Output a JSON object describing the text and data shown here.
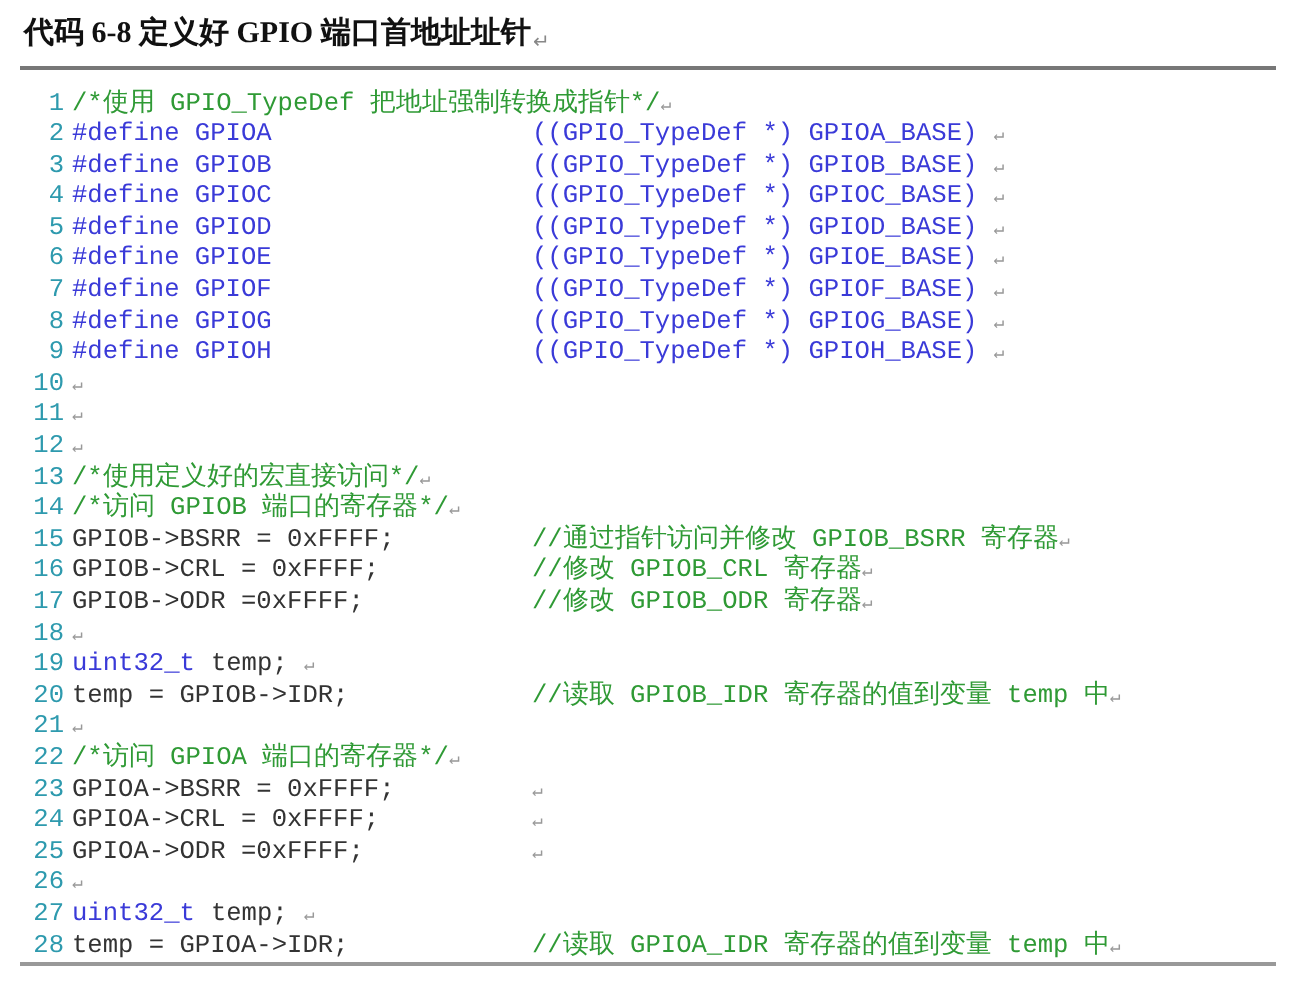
{
  "caption": {
    "text": "代码 6-8 定义好 GPIO 端口首地址址针",
    "mark": "↵"
  },
  "lines": [
    {
      "number": "1",
      "code": [
        {
          "kind": "comment",
          "text": "/*使用 GPIO_TypeDef 把地址强制转换成指针*/"
        },
        {
          "kind": "mark",
          "text": "↵"
        }
      ]
    },
    {
      "number": "2",
      "code": [
        {
          "kind": "keyword",
          "text": "#define GPIOA"
        }
      ],
      "tail": [
        {
          "kind": "keyword",
          "text": "((GPIO_TypeDef *) GPIOA_BASE)"
        },
        {
          "kind": "mark",
          "text": "↵"
        }
      ]
    },
    {
      "number": "3",
      "code": [
        {
          "kind": "keyword",
          "text": "#define GPIOB"
        }
      ],
      "tail": [
        {
          "kind": "keyword",
          "text": "((GPIO_TypeDef *) GPIOB_BASE)"
        },
        {
          "kind": "mark",
          "text": "↵"
        }
      ]
    },
    {
      "number": "4",
      "code": [
        {
          "kind": "keyword",
          "text": "#define GPIOC"
        }
      ],
      "tail": [
        {
          "kind": "keyword",
          "text": "((GPIO_TypeDef *) GPIOC_BASE)"
        },
        {
          "kind": "mark",
          "text": "↵"
        }
      ]
    },
    {
      "number": "5",
      "code": [
        {
          "kind": "keyword",
          "text": "#define GPIOD"
        }
      ],
      "tail": [
        {
          "kind": "keyword",
          "text": "((GPIO_TypeDef *) GPIOD_BASE)"
        },
        {
          "kind": "mark",
          "text": "↵"
        }
      ]
    },
    {
      "number": "6",
      "code": [
        {
          "kind": "keyword",
          "text": "#define GPIOE"
        }
      ],
      "tail": [
        {
          "kind": "keyword",
          "text": "((GPIO_TypeDef *) GPIOE_BASE)"
        },
        {
          "kind": "mark",
          "text": "↵"
        }
      ]
    },
    {
      "number": "7",
      "code": [
        {
          "kind": "keyword",
          "text": "#define GPIOF"
        }
      ],
      "tail": [
        {
          "kind": "keyword",
          "text": "((GPIO_TypeDef *) GPIOF_BASE)"
        },
        {
          "kind": "mark",
          "text": "↵"
        }
      ]
    },
    {
      "number": "8",
      "code": [
        {
          "kind": "keyword",
          "text": "#define GPIOG"
        }
      ],
      "tail": [
        {
          "kind": "keyword",
          "text": "((GPIO_TypeDef *) GPIOG_BASE)"
        },
        {
          "kind": "mark",
          "text": "↵"
        }
      ]
    },
    {
      "number": "9",
      "code": [
        {
          "kind": "keyword",
          "text": "#define GPIOH"
        }
      ],
      "tail": [
        {
          "kind": "keyword",
          "text": "((GPIO_TypeDef *) GPIOH_BASE)"
        },
        {
          "kind": "mark",
          "text": "↵"
        }
      ]
    },
    {
      "number": "10",
      "code": [
        {
          "kind": "mark",
          "text": "↵"
        }
      ]
    },
    {
      "number": "11",
      "code": [
        {
          "kind": "mark",
          "text": "↵"
        }
      ]
    },
    {
      "number": "12",
      "code": [
        {
          "kind": "mark",
          "text": "↵"
        }
      ]
    },
    {
      "number": "13",
      "code": [
        {
          "kind": "comment",
          "text": "/*使用定义好的宏直接访问*/"
        },
        {
          "kind": "mark",
          "text": "↵"
        }
      ]
    },
    {
      "number": "14",
      "code": [
        {
          "kind": "comment",
          "text": "/*访问 GPIOB 端口的寄存器*/"
        },
        {
          "kind": "mark",
          "text": "↵"
        }
      ]
    },
    {
      "number": "15",
      "code": [
        {
          "kind": "plain",
          "text": "GPIOB->BSRR = 0xFFFF;"
        }
      ],
      "tail": [
        {
          "kind": "comment",
          "text": "//通过指针访问并修改 GPIOB_BSRR 寄存器"
        },
        {
          "kind": "mark",
          "text": "↵"
        }
      ]
    },
    {
      "number": "16",
      "code": [
        {
          "kind": "plain",
          "text": "GPIOB->CRL = 0xFFFF;"
        }
      ],
      "tail": [
        {
          "kind": "comment",
          "text": "//修改 GPIOB_CRL 寄存器"
        },
        {
          "kind": "mark",
          "text": "↵"
        }
      ]
    },
    {
      "number": "17",
      "code": [
        {
          "kind": "plain",
          "text": "GPIOB->ODR =0xFFFF;"
        }
      ],
      "tail": [
        {
          "kind": "comment",
          "text": "//修改 GPIOB_ODR 寄存器"
        },
        {
          "kind": "mark",
          "text": "↵"
        }
      ]
    },
    {
      "number": "18",
      "code": [
        {
          "kind": "mark",
          "text": "↵"
        }
      ]
    },
    {
      "number": "19",
      "code": [
        {
          "kind": "keyword",
          "text": "uint32_t"
        },
        {
          "kind": "plain",
          "text": "temp;"
        },
        {
          "kind": "mark",
          "text": "↵"
        }
      ]
    },
    {
      "number": "20",
      "code": [
        {
          "kind": "plain",
          "text": "temp = GPIOB->IDR;"
        }
      ],
      "tail": [
        {
          "kind": "comment",
          "text": "//读取 GPIOB_IDR 寄存器的值到变量 temp 中"
        },
        {
          "kind": "mark",
          "text": "↵"
        }
      ]
    },
    {
      "number": "21",
      "code": [
        {
          "kind": "mark",
          "text": "↵"
        }
      ]
    },
    {
      "number": "22",
      "code": [
        {
          "kind": "comment",
          "text": "/*访问 GPIOA 端口的寄存器*/"
        },
        {
          "kind": "mark",
          "text": "↵"
        }
      ]
    },
    {
      "number": "23",
      "code": [
        {
          "kind": "plain",
          "text": "GPIOA->BSRR = 0xFFFF;"
        }
      ],
      "tail": [
        {
          "kind": "mark",
          "text": "↵"
        }
      ]
    },
    {
      "number": "24",
      "code": [
        {
          "kind": "plain",
          "text": "GPIOA->CRL = 0xFFFF;"
        }
      ],
      "tail": [
        {
          "kind": "mark",
          "text": "↵"
        }
      ]
    },
    {
      "number": "25",
      "code": [
        {
          "kind": "plain",
          "text": "GPIOA->ODR =0xFFFF;"
        }
      ],
      "tail": [
        {
          "kind": "mark",
          "text": "↵"
        }
      ]
    },
    {
      "number": "26",
      "code": [
        {
          "kind": "mark",
          "text": "↵"
        }
      ]
    },
    {
      "number": "27",
      "code": [
        {
          "kind": "keyword",
          "text": "uint32_t"
        },
        {
          "kind": "plain",
          "text": "temp;"
        },
        {
          "kind": "mark",
          "text": "↵"
        }
      ]
    },
    {
      "number": "28",
      "code": [
        {
          "kind": "plain",
          "text": "temp = GPIOA->IDR;"
        }
      ],
      "tail": [
        {
          "kind": "comment",
          "text": "//读取 GPIOA_IDR 寄存器的值到变量 temp 中"
        },
        {
          "kind": "mark",
          "text": "↵"
        }
      ]
    }
  ]
}
